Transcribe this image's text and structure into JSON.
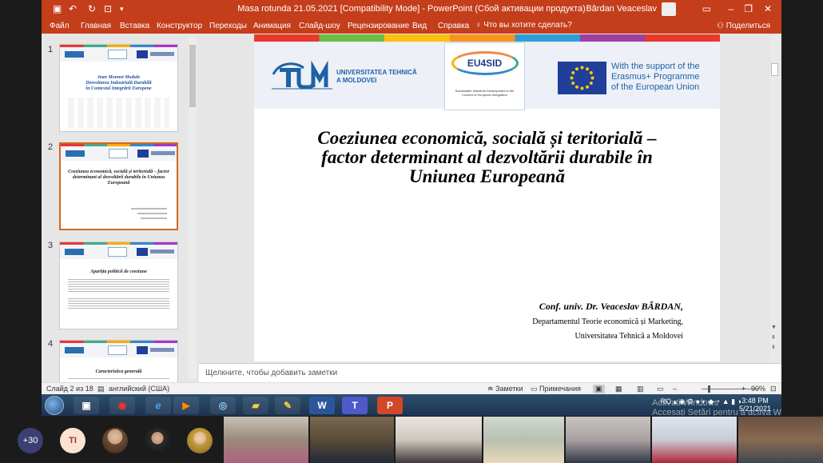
{
  "titlebar": {
    "doc_title": "Masa rotunda 21.05.2021 [Compatibility Mode]  -  PowerPoint (Сбой активации продукта)",
    "user_name": "Bârdan Veaceslav"
  },
  "ribbon": {
    "tabs": [
      "Файл",
      "Главная",
      "Вставка",
      "Конструктор",
      "Переходы",
      "Анимация",
      "Слайд-шоу",
      "Рецензирование",
      "Вид",
      "Справка"
    ],
    "search_label": "Что вы хотите сделать?",
    "share_label": "Поделиться"
  },
  "thumbnails": [
    {
      "num": "1",
      "title": "Jean Monnet Module\nDezvoltarea Industrială Durabilă\nîn Contextul Integrării Europene"
    },
    {
      "num": "2",
      "title": "Coeziunea economică, socială și teritorială – factor determinant al dezvoltării durabile în Uniunea Europeană"
    },
    {
      "num": "3",
      "title": "Apariția politicii de coeziune"
    },
    {
      "num": "4",
      "title": "Caracteristica generală"
    }
  ],
  "slide": {
    "university_name": "UNIVERSITATEA TEHNICĂ\nA MOLDOVEI",
    "eu4sid_label": "EU4SID",
    "eu4sid_sub": "Sustainable Industrial Development in the Context of European Integration",
    "eu_support": "With the support of the\nErasmus+ Programme\nof the European Union",
    "title": "Coeziunea economică, socială și teritorială –\nfactor determinant al dezvoltării durabile în\nUniunea Europeană",
    "author": "Conf. univ. Dr. Veaceslav BÂRDAN,",
    "department": "Departamentul Teorie economică și Marketing,",
    "university": "Universitatea Tehnică a Moldovei"
  },
  "notes": {
    "placeholder": "Щелкните, чтобы добавить заметки"
  },
  "statusbar": {
    "slide_counter": "Слайд 2 из 18",
    "language": "английский (США)",
    "notes_btn": "Заметки",
    "comments_btn": "Примечания",
    "zoom_percent": "90%",
    "zoom_level": 0.45
  },
  "taskbar": {
    "apps": [
      "word-icon",
      "teams-icon",
      "powerpoint-icon"
    ],
    "word_label": "W",
    "teams_label": "T",
    "ppt_label": "P",
    "lang": "RO",
    "time": "3:48 PM",
    "date": "5/21/2021"
  },
  "watermark": {
    "line1": "Activati Windows",
    "line2": "Accesați Setări pentru a activa Windows."
  },
  "participants": {
    "more_count": "+30",
    "initials": "TI"
  },
  "colors": {
    "office_accent": "#c43e1c",
    "thumb_selected": "#d2691e",
    "eu_blue": "#1f3f9a"
  }
}
